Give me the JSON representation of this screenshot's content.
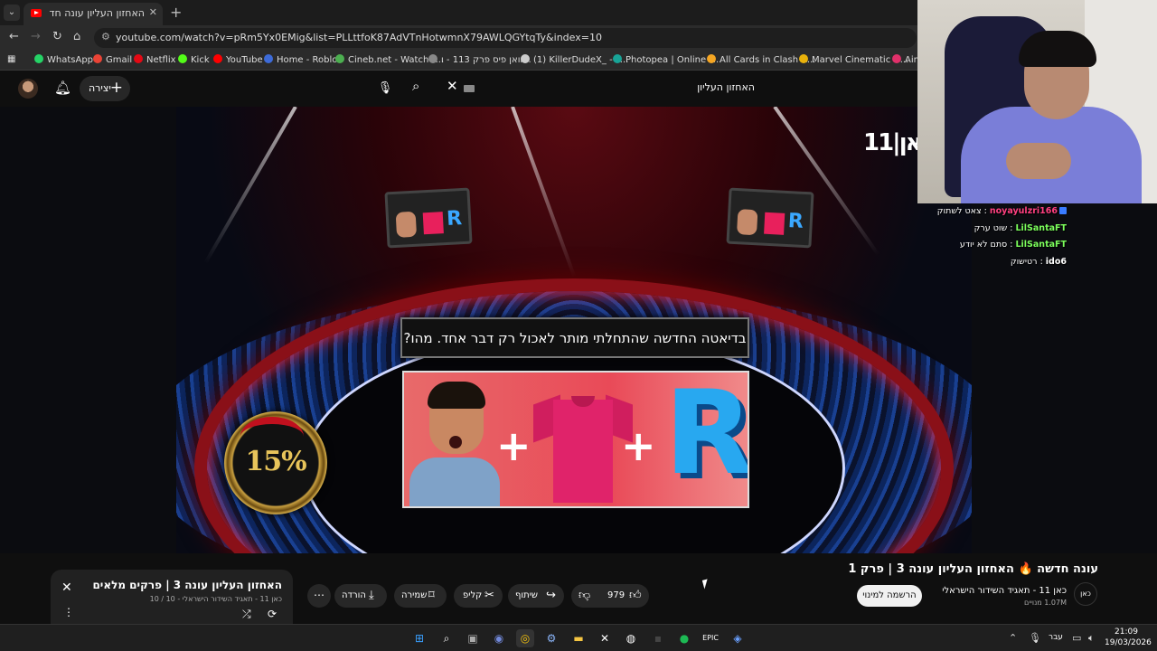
{
  "browser": {
    "tab_title": "האחזון העליון עונה חדשה 🔥 האחזון הע…",
    "url": "youtube.com/watch?v=pRm5Yx0EMig&list=PLLttfoK87AdVTnHotwmnX79AWLQGYtqTy&index=10",
    "bookmarks": [
      {
        "label": "WhatsApp",
        "color": "#25d366"
      },
      {
        "label": "Gmail",
        "color": "#ea4335"
      },
      {
        "label": "Netflix",
        "color": "#e50914"
      },
      {
        "label": "Kick",
        "color": "#53fc18"
      },
      {
        "label": "YouTube",
        "color": "#ff0000"
      },
      {
        "label": "Home - Roblox",
        "color": "#3d6bd8"
      },
      {
        "label": "Cineb.net - Watch F...",
        "color": "#4caf50"
      },
      {
        "label": "וואן פיס פרק 113 - ו...",
        "color": "#888888"
      },
      {
        "label": "(1) KillerDudeX_ - T...",
        "color": "#cccccc"
      },
      {
        "label": "Photopea | Online P...",
        "color": "#18a497"
      },
      {
        "label": "All Cards in Clash R...",
        "color": "#f5a623"
      },
      {
        "label": "Marvel Cinematic U...",
        "color": "#e8b10b"
      },
      {
        "label": "Aim",
        "color": "#e0306a"
      }
    ]
  },
  "youtube": {
    "create_label": "יצירה",
    "search_query": "האחזון העליון"
  },
  "video": {
    "channel_logo_text": "11|כאן",
    "question": "בדיאטה החדשה שהתחלתי מותר לאכול רק דבר אחד. מהו?",
    "timer_text": "15%",
    "title": "עונה חדשה 🔥 האחזון העליון עונה 3 | פרק 1",
    "channel_name": "כאן 11 - תאגיד השידור הישראלי",
    "channel_subs": "1.07M מנויים",
    "channel_avatar_text": "כאן",
    "subscribe_label": "הרשמה למינוי",
    "actions": {
      "likes": "979",
      "share": "שיתוף",
      "clip": "קליפ",
      "save": "שמירה",
      "download": "הורדה"
    }
  },
  "playlist": {
    "title": "האחזון העליון עונה 3 | פרקים מלאים",
    "subtitle": "כאן 11 - תאגיד השידור הישראלי - 10 / 10"
  },
  "chat": [
    {
      "user": "noyayulzri166",
      "message": "צאט לשתוק",
      "user_color": "#ff4080"
    },
    {
      "user": "LilSantaFT",
      "message": "שוט ערק",
      "user_color": "#7cff5c"
    },
    {
      "user": "LilSantaFT",
      "message": "סתם לא יודע",
      "user_color": "#7cff5c"
    },
    {
      "user": "ido6",
      "message": "רטישוק",
      "user_color": "#ffffff"
    }
  ],
  "taskbar": {
    "language": "עבר",
    "time": "21:09",
    "date": "19/03/2026"
  }
}
